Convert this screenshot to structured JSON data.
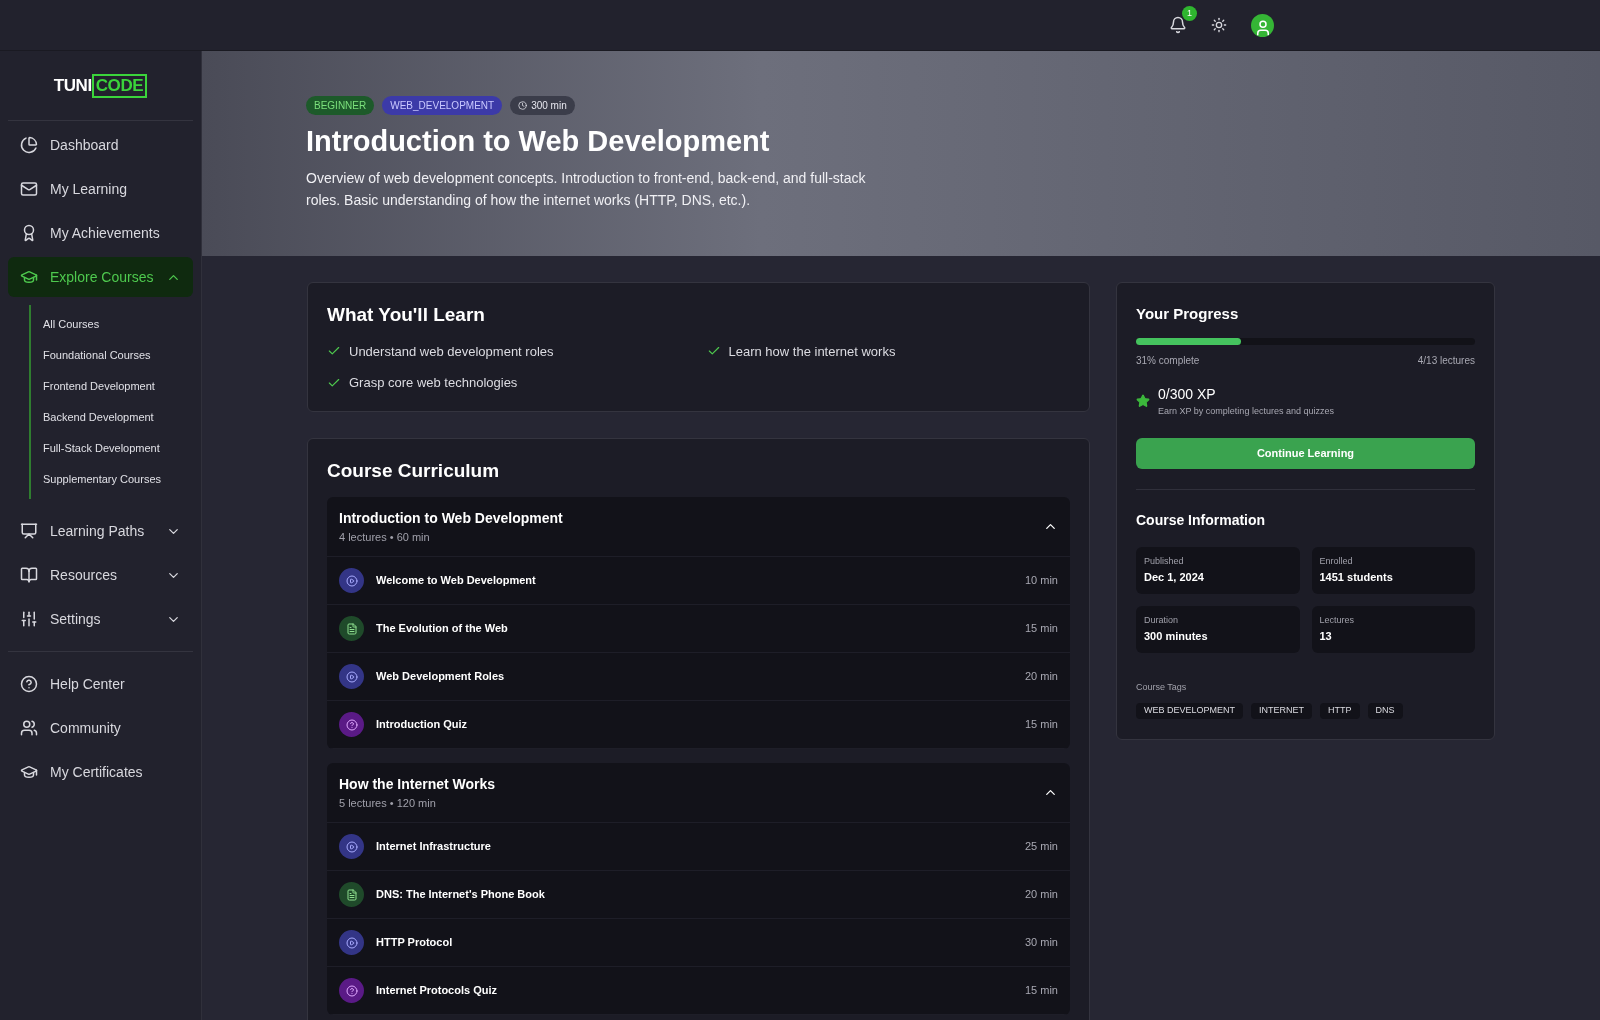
{
  "topbar": {
    "notification_count": "1"
  },
  "logo": {
    "part1": "TUNI",
    "part2": "CODE"
  },
  "sidebar": {
    "items": [
      {
        "label": "Dashboard",
        "kind": "link",
        "selected": false
      },
      {
        "label": "My Learning",
        "kind": "link",
        "selected": false
      },
      {
        "label": "My Achievements",
        "kind": "link",
        "selected": false
      },
      {
        "label": "Explore Courses",
        "kind": "group",
        "selected": true,
        "expanded": true,
        "children": [
          {
            "label": "All Courses"
          },
          {
            "label": "Foundational Courses"
          },
          {
            "label": "Frontend Development"
          },
          {
            "label": "Backend Development"
          },
          {
            "label": "Full-Stack Development"
          },
          {
            "label": "Supplementary Courses"
          }
        ]
      },
      {
        "label": "Learning Paths",
        "kind": "group",
        "selected": false,
        "expanded": false
      },
      {
        "label": "Resources",
        "kind": "group",
        "selected": false,
        "expanded": false
      },
      {
        "label": "Settings",
        "kind": "group",
        "selected": false,
        "expanded": false
      }
    ],
    "footer_items": [
      {
        "label": "Help Center",
        "selected": false
      },
      {
        "label": "Community",
        "selected": false
      },
      {
        "label": "My Certificates",
        "selected": false
      }
    ]
  },
  "hero": {
    "badges": [
      {
        "label": "BEGINNER",
        "kind": "level"
      },
      {
        "label": "WEB_DEVELOPMENT",
        "kind": "category"
      },
      {
        "label": "300 min",
        "kind": "duration"
      }
    ],
    "title": "Introduction to Web Development",
    "description": "Overview of web development concepts. Introduction to front-end, back-end, and full-stack roles. Basic understanding of how the internet works (HTTP, DNS, etc.)."
  },
  "learn": {
    "title": "What You'll Learn",
    "items": [
      "Understand web development roles",
      "Learn how the internet works",
      "Grasp core web technologies"
    ]
  },
  "curriculum": {
    "title": "Course Curriculum",
    "sections": [
      {
        "title": "Introduction to Web Development",
        "meta": "4 lectures • 60 min",
        "expanded": true,
        "lectures": [
          {
            "title": "Welcome to Web Development",
            "kind": "video",
            "duration": "10 min"
          },
          {
            "title": "The Evolution of the Web",
            "kind": "reading",
            "duration": "15 min"
          },
          {
            "title": "Web Development Roles",
            "kind": "video",
            "duration": "20 min"
          },
          {
            "title": "Introduction Quiz",
            "kind": "quiz",
            "duration": "15 min"
          }
        ]
      },
      {
        "title": "How the Internet Works",
        "meta": "5 lectures • 120 min",
        "expanded": true,
        "lectures": [
          {
            "title": "Internet Infrastructure",
            "kind": "video",
            "duration": "25 min"
          },
          {
            "title": "DNS: The Internet's Phone Book",
            "kind": "reading",
            "duration": "20 min"
          },
          {
            "title": "HTTP Protocol",
            "kind": "video",
            "duration": "30 min"
          },
          {
            "title": "Internet Protocols Quiz",
            "kind": "quiz",
            "duration": "15 min"
          }
        ]
      }
    ]
  },
  "progress": {
    "title": "Your Progress",
    "level": 0.31,
    "percent_text": "31% complete",
    "lectures_text": "4/13 lectures",
    "xp": "0/300 XP",
    "xp_hint": "Earn XP by completing lectures and quizzes",
    "button": "Continue Learning"
  },
  "info": {
    "title": "Course Information",
    "fields": [
      {
        "label": "Published",
        "value": "Dec 1, 2024"
      },
      {
        "label": "Enrolled",
        "value": "1451 students"
      },
      {
        "label": "Duration",
        "value": "300 minutes"
      },
      {
        "label": "Lectures",
        "value": "13"
      }
    ],
    "tags_label": "Course Tags",
    "tags": [
      "WEB DEVELOPMENT",
      "INTERNET",
      "HTTP",
      "DNS"
    ]
  }
}
